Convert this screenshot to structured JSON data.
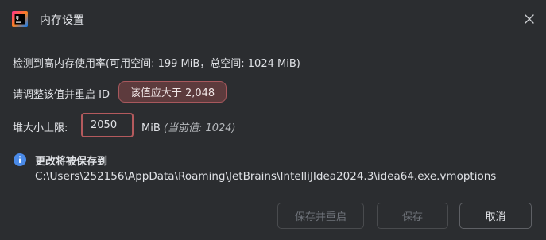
{
  "dialog": {
    "title": "内存设置",
    "icon": "jetbrains-logo-icon",
    "close_icon": "close-icon"
  },
  "memory_info": "检测到高内存使用率(可用空间: 199 MiB，总空间: 1024 MiB)",
  "adjust_text": "请调整该值并重启 ID",
  "tooltip": "该值应大于 2,048",
  "heap": {
    "label": "堆大小上限:",
    "value": "2050",
    "unit": "MiB",
    "current": "(当前值: 1024)"
  },
  "save_info": {
    "icon": "info-icon",
    "title": "更改将被保存到",
    "path": "C:\\Users\\252156\\AppData\\Roaming\\JetBrains\\IntelliJIdea2024.3\\idea64.exe.vmoptions"
  },
  "buttons": {
    "save_restart": "保存并重启",
    "save": "保存",
    "cancel": "取消"
  },
  "colors": {
    "background": "#2b2d30",
    "error_border": "#b45a5d",
    "tooltip_bg": "#5d3b3d",
    "info_blue": "#4a8ae8"
  }
}
